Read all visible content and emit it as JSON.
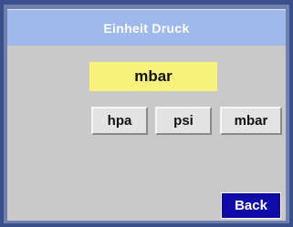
{
  "title": "Einheit Druck",
  "current_value": "mbar",
  "unit_options": [
    "hpa",
    "psi",
    "mbar"
  ],
  "back_label": "Back",
  "colors": {
    "title_bar": "#9fb9ec",
    "screen_background": "#c9c9c9",
    "value_highlight": "#f7f27a",
    "back_button": "#0f0aa8",
    "frame": "#3a4f8c"
  }
}
